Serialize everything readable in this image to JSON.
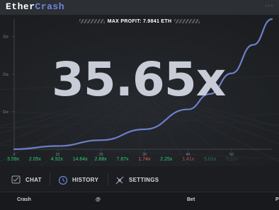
{
  "header": {
    "logo_part1": "Ether",
    "logo_part2": "Crash"
  },
  "game": {
    "max_profit_label": "MAX PROFIT: 7.9841 ETH",
    "current_multiplier": "35.65x"
  },
  "chart_data": {
    "type": "line",
    "x_tick_labels": [
      "0",
      "10",
      "20",
      "30",
      "40",
      "50"
    ],
    "y_tick_labels": [
      "31x",
      "21x",
      "11x"
    ],
    "x_range": [
      0,
      59.3
    ],
    "y_range": [
      1,
      35.65
    ],
    "series": [
      {
        "x": [
          0,
          10,
          20,
          30,
          40,
          45,
          50,
          55,
          59.3
        ],
        "y": [
          1.0,
          1.85,
          3.4,
          6.3,
          11.6,
          15.7,
          21.2,
          28.8,
          35.65
        ]
      }
    ],
    "grid": true
  },
  "history": [
    {
      "value": "3.59x",
      "color": "#2ecc71"
    },
    {
      "value": "2.05x",
      "color": "#2ecc71"
    },
    {
      "value": "4.92x",
      "color": "#2ecc71"
    },
    {
      "value": "14.64x",
      "color": "#2ecc71"
    },
    {
      "value": "2.88x",
      "color": "#2ecc71"
    },
    {
      "value": "7.87x",
      "color": "#2ecc71"
    },
    {
      "value": "1.74x",
      "color": "#e55a4f"
    },
    {
      "value": "2.25x",
      "color": "#2ecc71"
    },
    {
      "value": "1.41x",
      "color": "#e55a4f"
    },
    {
      "value": "5.01x",
      "color": "#2ecc71"
    },
    {
      "value": "5.32x",
      "color": "#2ecc71"
    }
  ],
  "tabs": {
    "chat": "CHAT",
    "history": "HISTORY",
    "settings": "SETTINGS"
  },
  "table": {
    "col_crash": "Crash",
    "col_at": "@",
    "col_bet": "Bet",
    "col_profit": "P"
  },
  "icons": {
    "chat": "chat-icon",
    "history": "clock-icon",
    "settings": "settings-icon"
  },
  "colors": {
    "accent": "#6f86d9",
    "win": "#2ecc71",
    "loss": "#e55a4f",
    "curve": "#6d7fc9"
  }
}
